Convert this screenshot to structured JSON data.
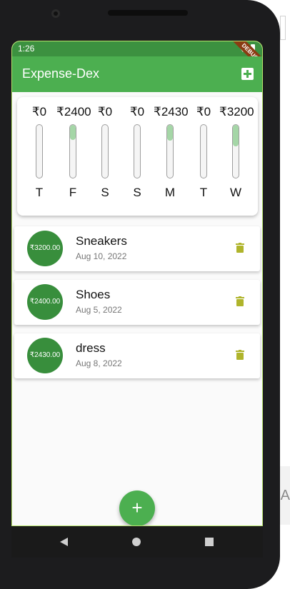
{
  "status_bar": {
    "time": "1:26",
    "debug_label": "DEBUG"
  },
  "app_bar": {
    "title": "Expense-Dex",
    "add_icon": "add-box-icon"
  },
  "chart": {
    "days": [
      {
        "day": "T",
        "amount": "₹0",
        "fill": 0
      },
      {
        "day": "F",
        "amount": "₹2400",
        "fill": 0.29
      },
      {
        "day": "S",
        "amount": "₹0",
        "fill": 0
      },
      {
        "day": "S",
        "amount": "₹0",
        "fill": 0
      },
      {
        "day": "M",
        "amount": "₹2430",
        "fill": 0.3
      },
      {
        "day": "T",
        "amount": "₹0",
        "fill": 0
      },
      {
        "day": "W",
        "amount": "₹3200",
        "fill": 0.4
      }
    ]
  },
  "transactions": [
    {
      "amount": "₹3200.00",
      "title": "Sneakers",
      "date": "Aug 10, 2022"
    },
    {
      "amount": "₹2400.00",
      "title": "Shoes",
      "date": "Aug 5, 2022"
    },
    {
      "amount": "₹2430.00",
      "title": "dress",
      "date": "Aug 8, 2022"
    }
  ],
  "fab": {
    "label": "+"
  },
  "external_strip_text": "A",
  "colors": {
    "primary": "#4caf50",
    "primary_dark": "#3c9140",
    "avatar": "#388e3c",
    "trash": "#afb42b"
  }
}
